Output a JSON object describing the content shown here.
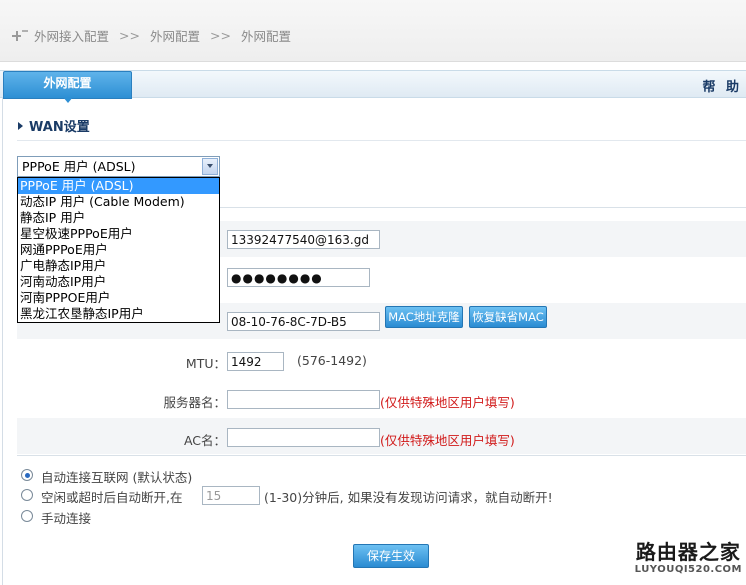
{
  "breadcrumb": {
    "items": [
      "外网接入配置",
      "外网配置",
      "外网配置"
    ],
    "separator": ">>"
  },
  "tabs": {
    "active_label": "外网配置",
    "help_label": "帮 助"
  },
  "section": {
    "title": "WAN设置"
  },
  "connection_type": {
    "selected": "PPPoE 用户 (ADSL)",
    "options": [
      "PPPoE 用户 (ADSL)",
      "动态IP 用户 (Cable Modem)",
      "静态IP 用户",
      "星空极速PPPoE用户",
      "网通PPPoE用户",
      "广电静态IP用户",
      "河南动态IP用户",
      "河南PPPOE用户",
      "黑龙江农垦静态IP用户"
    ]
  },
  "form": {
    "account_value": "13392477540@163.gd",
    "password_value": "●●●●●●●●",
    "mac_value": "08-10-76-8C-7D-B5",
    "mac_clone_label": "MAC地址克隆",
    "mac_restore_label": "恢复缺省MAC",
    "mtu_label": "MTU：",
    "mtu_value": "1492",
    "mtu_range": "(576-1492)",
    "server_label": "服务器名：",
    "server_value": "",
    "server_hint": "(仅供特殊地区用户填写)",
    "ac_label": "AC名：",
    "ac_value": "",
    "ac_hint": "(仅供特殊地区用户填写)"
  },
  "connect_mode": {
    "auto_label": "自动连接互联网 (默认状态)",
    "idle_prefix": "空闲或超时后自动断开,在",
    "idle_value": "15",
    "idle_suffix": "(1-30)分钟后, 如果没有发现访问请求，就自动断开!",
    "manual_label": "手动连接",
    "selected": "auto"
  },
  "save_label": "保存生效",
  "watermark": {
    "main": "路由器之家",
    "sub": "LUYOUQI520.COM"
  }
}
